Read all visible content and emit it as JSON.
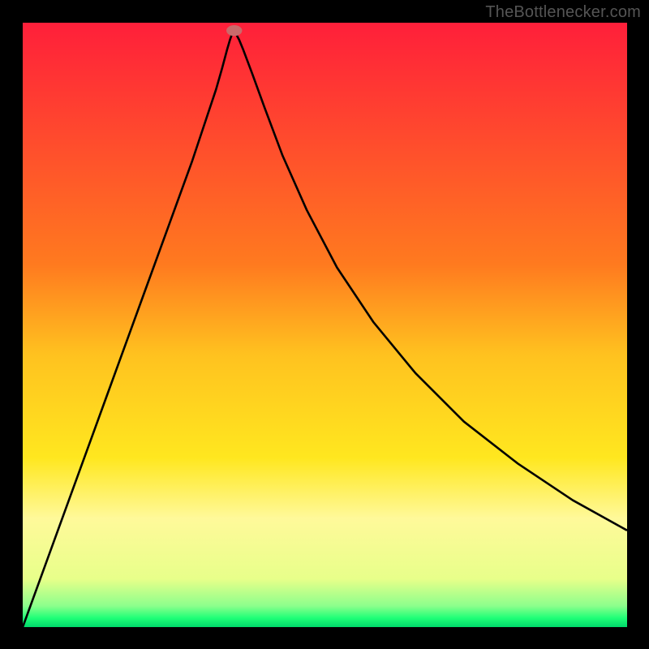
{
  "watermark": "TheBottlenecker.com",
  "chart_data": {
    "type": "line",
    "title": "",
    "xlabel": "",
    "ylabel": "",
    "xlim": [
      0,
      100
    ],
    "ylim": [
      0,
      100
    ],
    "background": {
      "gradient_stops": [
        {
          "offset": 0,
          "color": "#ff1f3a"
        },
        {
          "offset": 40,
          "color": "#ff7a1f"
        },
        {
          "offset": 55,
          "color": "#ffc21f"
        },
        {
          "offset": 72,
          "color": "#ffe71f"
        },
        {
          "offset": 82,
          "color": "#fff99a"
        },
        {
          "offset": 92,
          "color": "#e8ff8a"
        },
        {
          "offset": 96.5,
          "color": "#8cff8c"
        },
        {
          "offset": 98.5,
          "color": "#1fff77"
        },
        {
          "offset": 100,
          "color": "#00d96b"
        }
      ]
    },
    "curve": {
      "x": [
        0,
        4,
        8,
        12,
        16,
        20,
        24,
        28,
        30,
        32,
        33,
        33.8,
        34.3,
        34.7,
        35.2,
        35.8,
        36.5,
        38,
        40,
        43,
        47,
        52,
        58,
        65,
        73,
        82,
        91,
        100
      ],
      "y": [
        0,
        11,
        22,
        33,
        44,
        55,
        66,
        77,
        83,
        89,
        92.5,
        95.5,
        97.2,
        98.3,
        98.3,
        97.2,
        95.5,
        91.5,
        86,
        78,
        69,
        59.5,
        50.5,
        42,
        34,
        27,
        21,
        16
      ]
    },
    "marker": {
      "x": 35,
      "y": 98.7,
      "rx": 1.3,
      "ry": 0.9,
      "color": "#c96b6b"
    }
  }
}
